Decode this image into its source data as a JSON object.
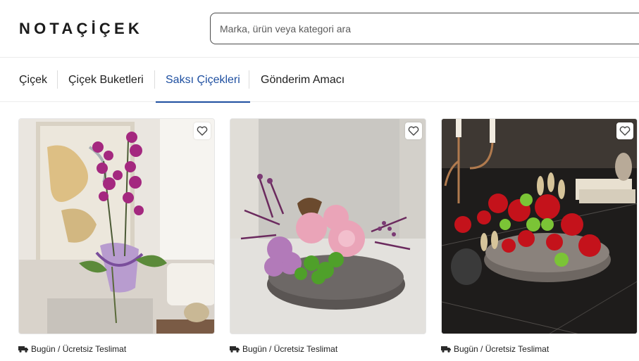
{
  "header": {
    "logo": "NOTAÇİÇEK",
    "search_placeholder": "Marka, ürün veya kategori ara"
  },
  "nav": {
    "tabs": [
      {
        "label": "Çiçek",
        "active": false
      },
      {
        "label": "Çiçek Buketleri",
        "active": false
      },
      {
        "label": "Saksı Çiçekleri",
        "active": true
      },
      {
        "label": "Gönderim Amacı",
        "active": false
      }
    ]
  },
  "products": [
    {
      "image": "purple orchid in lavender wrap",
      "delivery": "Bugün / Ücretsiz Teslimat"
    },
    {
      "image": "pink rose and chrysanthemum arrangement on stone tray",
      "delivery": "Bugün / Ücretsiz Teslimat"
    },
    {
      "image": "red rose arrangement with candlestick on marble table",
      "delivery": "Bugün / Ücretsiz Teslimat"
    }
  ],
  "icons": {
    "favorite": "heart-icon",
    "delivery": "truck-icon"
  },
  "colors": {
    "accent": "#1e4fa0",
    "text": "#1f1f1f"
  }
}
